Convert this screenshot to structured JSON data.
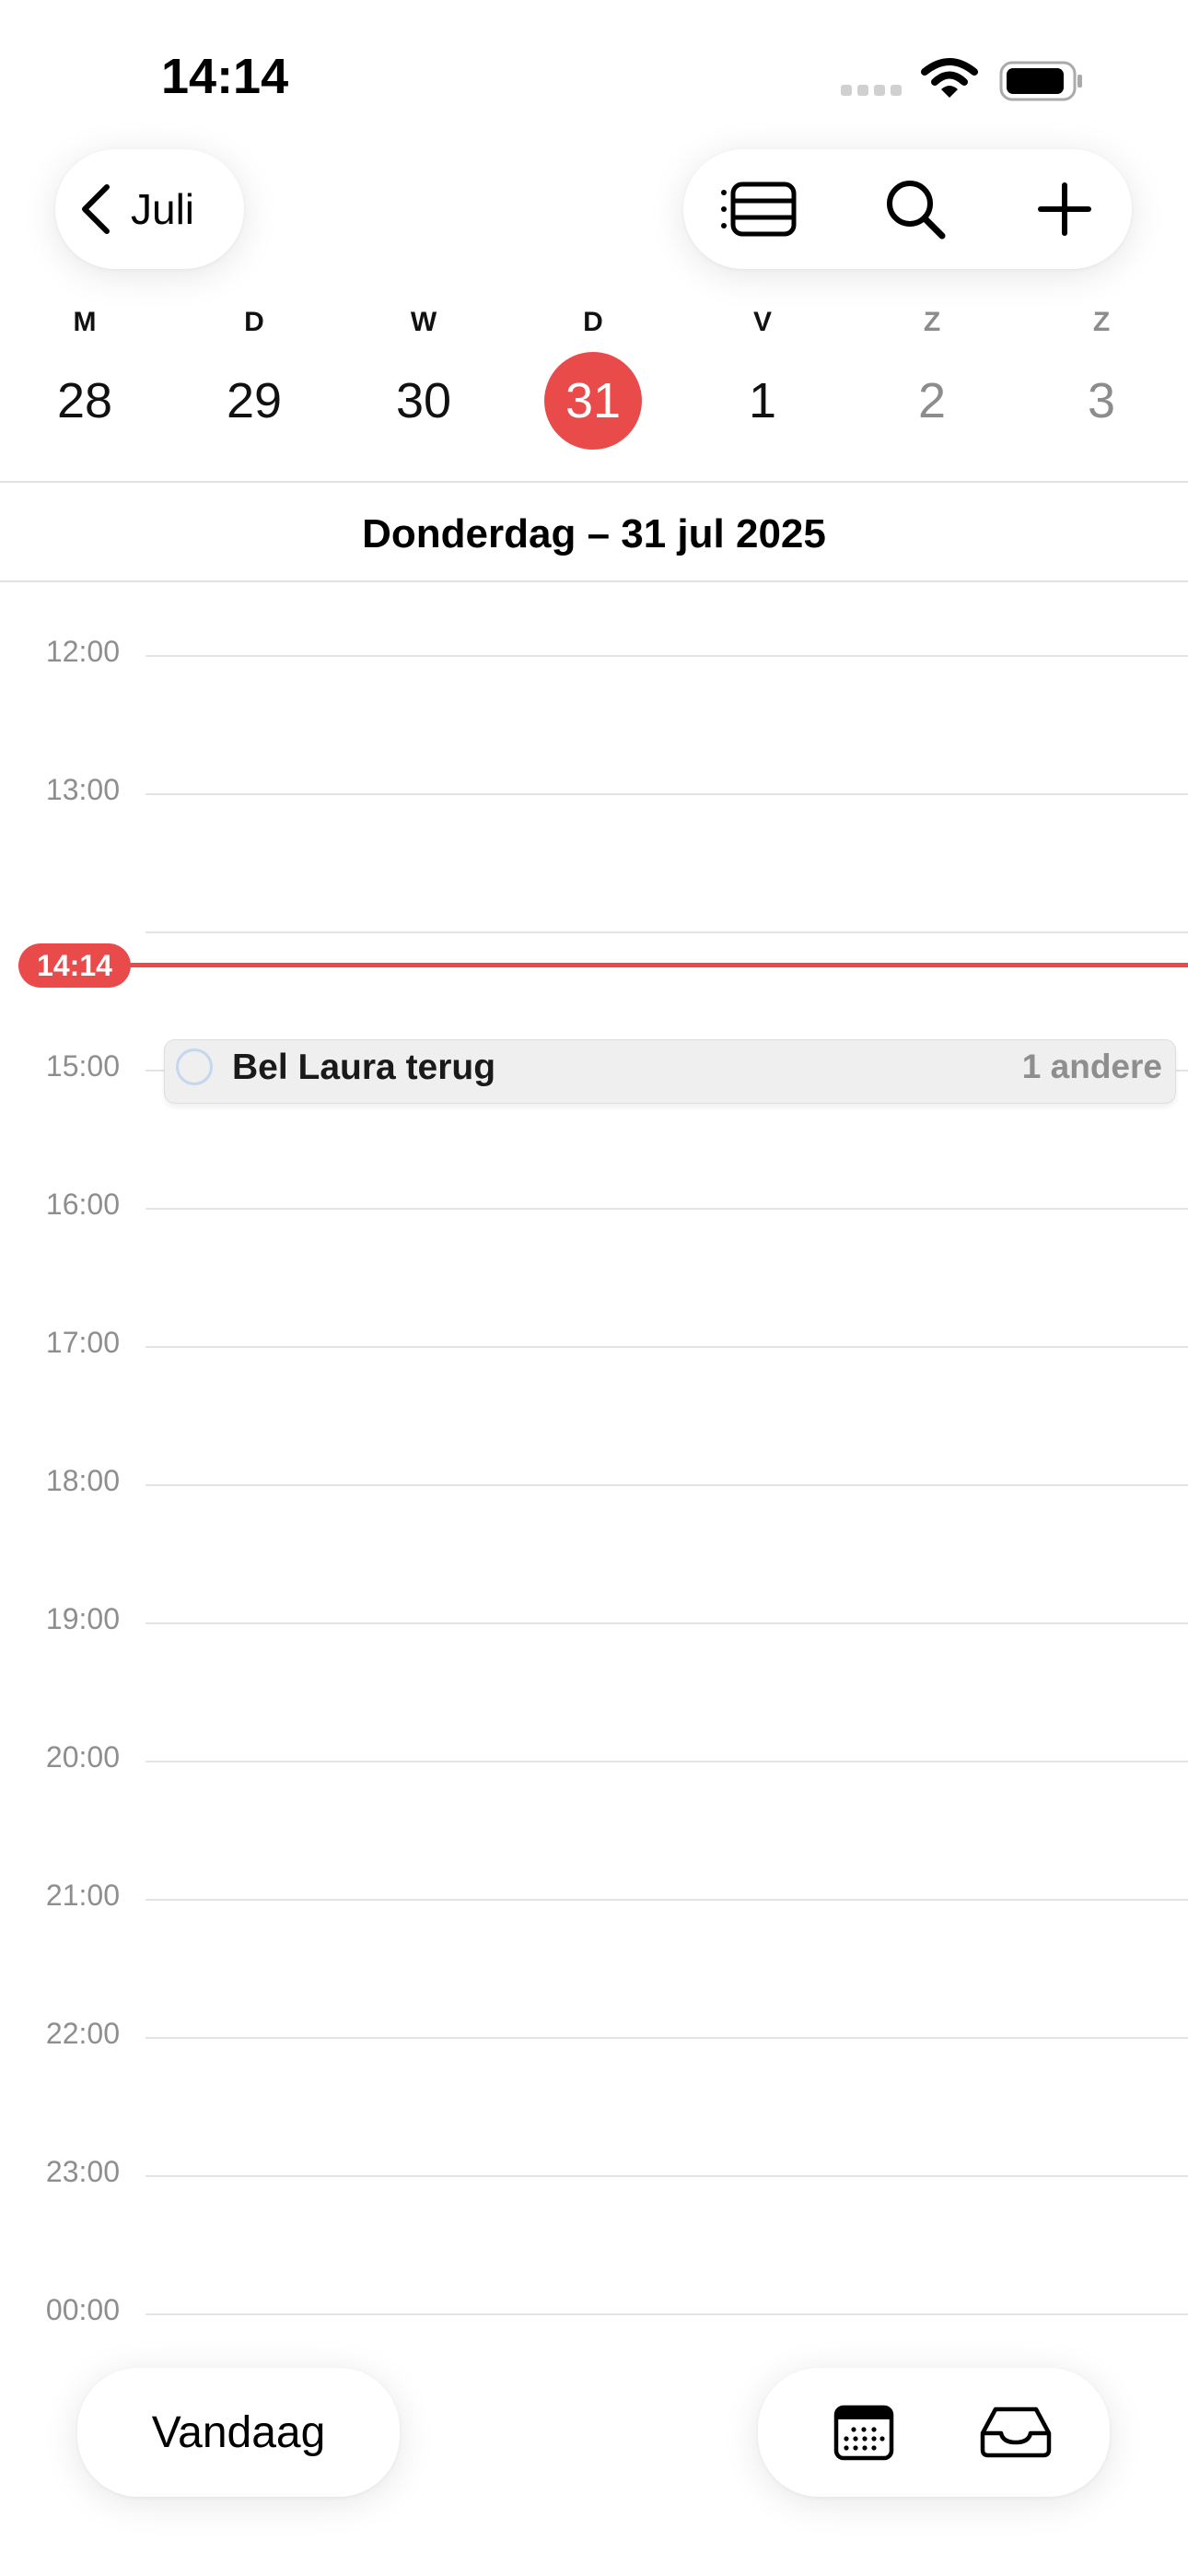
{
  "status_bar": {
    "time": "14:14"
  },
  "header": {
    "back_label": "Juli",
    "icons": [
      "list-view-icon",
      "search-icon",
      "add-icon"
    ]
  },
  "week": {
    "days": [
      {
        "letter": "M",
        "number": "28"
      },
      {
        "letter": "D",
        "number": "29"
      },
      {
        "letter": "W",
        "number": "30"
      },
      {
        "letter": "D",
        "number": "31",
        "selected": true
      },
      {
        "letter": "V",
        "number": "1"
      },
      {
        "letter": "Z",
        "number": "2",
        "weekend": true
      },
      {
        "letter": "Z",
        "number": "3",
        "weekend": true
      }
    ]
  },
  "day_title": "Donderdag – 31 jul 2025",
  "timeline": {
    "hours": [
      "12:00",
      "13:00",
      "15:00",
      "16:00",
      "17:00",
      "18:00",
      "19:00",
      "20:00",
      "21:00",
      "22:00",
      "23:00",
      "00:00"
    ],
    "now": "14:14"
  },
  "event": {
    "title": "Bel Laura terug",
    "more": "1 andere"
  },
  "footer": {
    "today_label": "Vandaag",
    "icons": [
      "calendar-icon",
      "inbox-icon"
    ]
  },
  "colors": {
    "accent": "#e94b4b",
    "gridline": "#e4e4e4",
    "muted_text": "#8e8e8e"
  }
}
